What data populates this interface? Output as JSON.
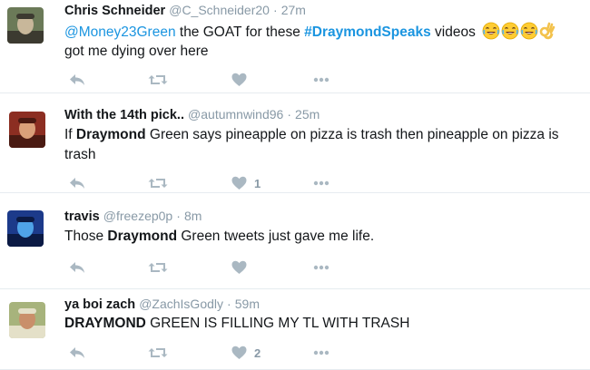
{
  "tweets": [
    {
      "name": "Chris Schneider",
      "handle": "@C_Schneider20",
      "sep": "·",
      "time": "27m",
      "segments": [
        {
          "type": "mention",
          "text": "@Money23Green"
        },
        {
          "type": "text",
          "text": " the GOAT for these "
        },
        {
          "type": "hashtag",
          "text": "#DraymondSpeaks"
        },
        {
          "type": "text",
          "text": " videos "
        }
      ],
      "line2": "got me dying over here",
      "emojis": [
        "face-with-tears-of-joy",
        "face-with-tears-of-joy",
        "face-with-tears-of-joy",
        "ok-hand"
      ],
      "like_count": "",
      "avatar_colors": [
        "#6b7a58",
        "#c8b79a",
        "#3c3a30"
      ]
    },
    {
      "name": "With the 14th pick..",
      "handle": "@autumnwind96",
      "sep": "·",
      "time": "25m",
      "segments": [
        {
          "type": "text",
          "text": "If "
        },
        {
          "type": "keyword",
          "text": "Draymond"
        },
        {
          "type": "text",
          "text": " Green says pineapple on pizza is trash then pineapple on pizza is"
        }
      ],
      "line2": "trash",
      "emojis": [],
      "like_count": "1",
      "avatar_colors": [
        "#8c2e22",
        "#d9a07a",
        "#4a1a12"
      ]
    },
    {
      "name": "travis",
      "handle": "@freezep0p",
      "sep": "·",
      "time": "8m",
      "segments": [
        {
          "type": "text",
          "text": "Those "
        },
        {
          "type": "keyword",
          "text": "Draymond"
        },
        {
          "type": "text",
          "text": " Green tweets just gave me life."
        }
      ],
      "line2": "",
      "emojis": [],
      "like_count": "",
      "avatar_colors": [
        "#1c3a8a",
        "#4fa3e8",
        "#0b1a44"
      ]
    },
    {
      "name": "ya boi zach",
      "handle": "@ZachIsGodly",
      "sep": "·",
      "time": "59m",
      "segments": [
        {
          "type": "keyword",
          "text": "DRAYMOND"
        },
        {
          "type": "text",
          "text": " GREEN IS FILLING MY TL WITH TRASH"
        }
      ],
      "line2": "",
      "emojis": [],
      "like_count": "2",
      "avatar_colors": [
        "#a7b37c",
        "#c98f6a",
        "#e4e0c8"
      ]
    }
  ],
  "icons": {
    "reply": "reply-icon",
    "retweet": "retweet-icon",
    "like": "heart-icon",
    "more": "more-icon"
  },
  "colors": {
    "link": "#1b95e0",
    "muted": "#8899a6",
    "icon": "#aab8c2",
    "text": "#14171a"
  }
}
